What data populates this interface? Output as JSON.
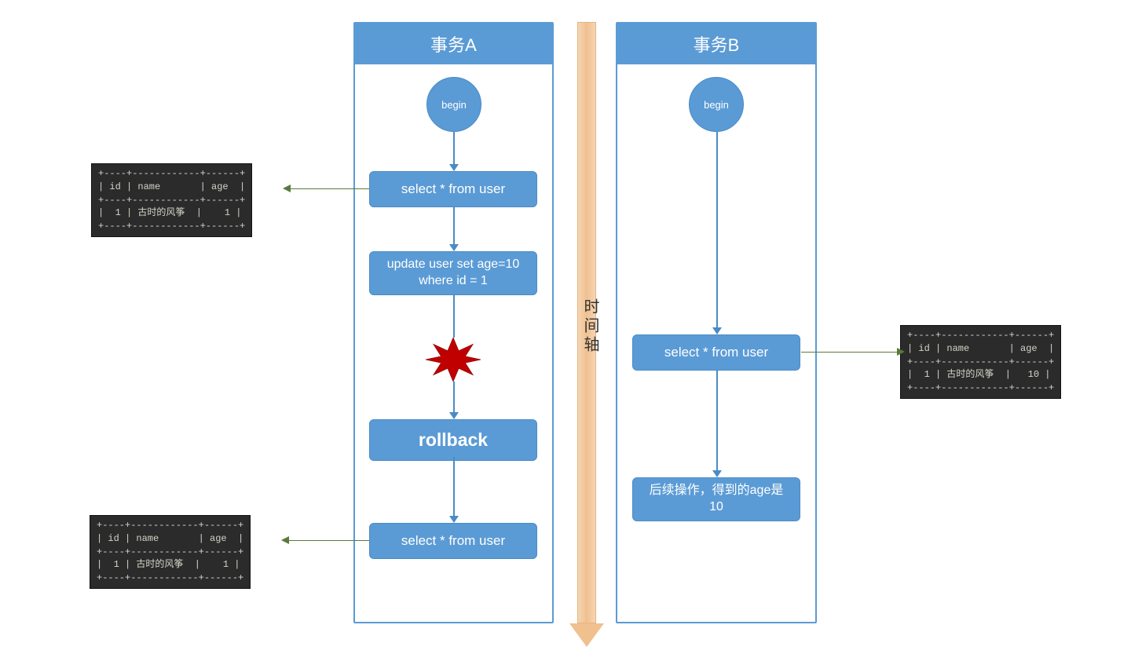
{
  "transactionA": {
    "title": "事务A",
    "begin": "begin",
    "step1": "select * from user",
    "step2": "update user set age=10 where id = 1",
    "step3": "rollback",
    "step4": "select * from user"
  },
  "transactionB": {
    "title": "事务B",
    "begin": "begin",
    "step1": "select * from user",
    "step2": "后续操作，得到的age是10"
  },
  "timeline": {
    "label": "时间轴"
  },
  "resultA1": "+----+------------+------+\n| id | name       | age  |\n+----+------------+------+\n|  1 | 古时的风筝  |    1 |\n+----+------------+------+",
  "resultA2": "+----+------------+------+\n| id | name       | age  |\n+----+------------+------+\n|  1 | 古时的风筝  |    1 |\n+----+------------+------+",
  "resultB1": "+----+------------+------+\n| id | name       | age  |\n+----+------------+------+\n|  1 | 古时的风筝  |   10 |\n+----+------------+------+"
}
